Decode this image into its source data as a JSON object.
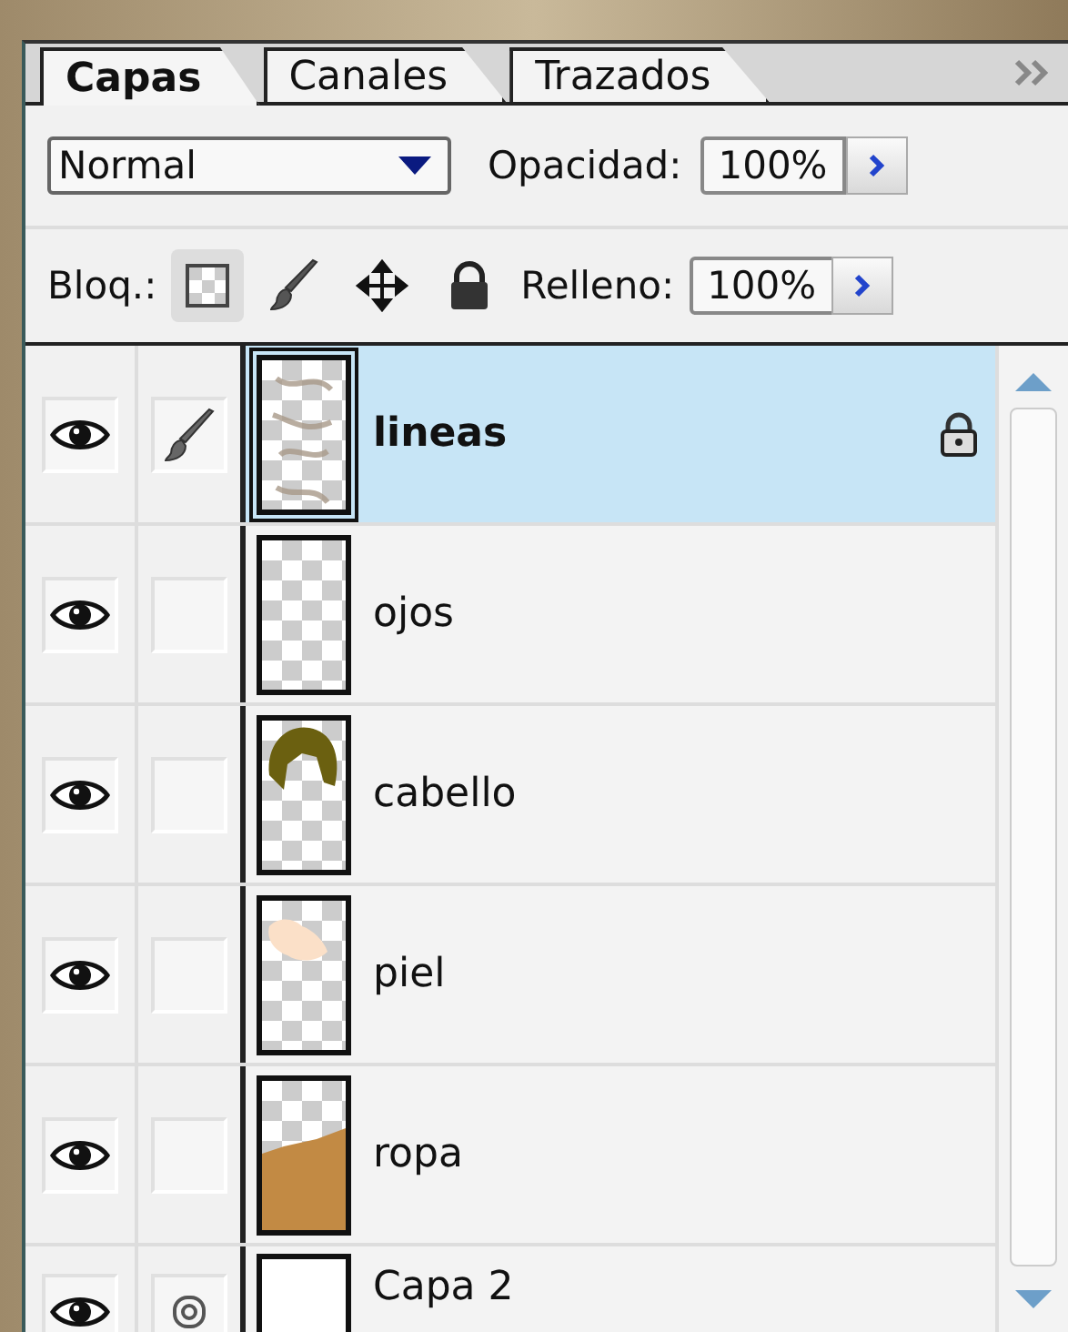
{
  "tabs": [
    {
      "label": "Capas",
      "selected": true
    },
    {
      "label": "Canales",
      "selected": false
    },
    {
      "label": "Trazados",
      "selected": false
    }
  ],
  "blend_mode": {
    "value": "Normal"
  },
  "opacity": {
    "label": "Opacidad:",
    "value": "100%"
  },
  "lock": {
    "label": "Bloq.:",
    "buttons": [
      {
        "kind": "transparency",
        "on": true
      },
      {
        "kind": "paint",
        "on": false
      },
      {
        "kind": "position",
        "on": false
      },
      {
        "kind": "all",
        "on": false
      }
    ]
  },
  "fill": {
    "label": "Relleno:",
    "value": "100%"
  },
  "layers": [
    {
      "name": "lineas",
      "selected": true,
      "visible": true,
      "painting": true,
      "linked": false,
      "locked": true,
      "kind": "sketch"
    },
    {
      "name": "ojos",
      "selected": false,
      "visible": true,
      "painting": false,
      "linked": false,
      "locked": false,
      "kind": "empty"
    },
    {
      "name": "cabello",
      "selected": false,
      "visible": true,
      "painting": false,
      "linked": false,
      "locked": false,
      "kind": "hair"
    },
    {
      "name": "piel",
      "selected": false,
      "visible": true,
      "painting": false,
      "linked": false,
      "locked": false,
      "kind": "skin"
    },
    {
      "name": "ropa",
      "selected": false,
      "visible": true,
      "painting": false,
      "linked": false,
      "locked": false,
      "kind": "clothes"
    },
    {
      "name": "Capa 2",
      "selected": false,
      "visible": true,
      "painting": false,
      "linked": true,
      "locked": false,
      "kind": "white"
    }
  ]
}
